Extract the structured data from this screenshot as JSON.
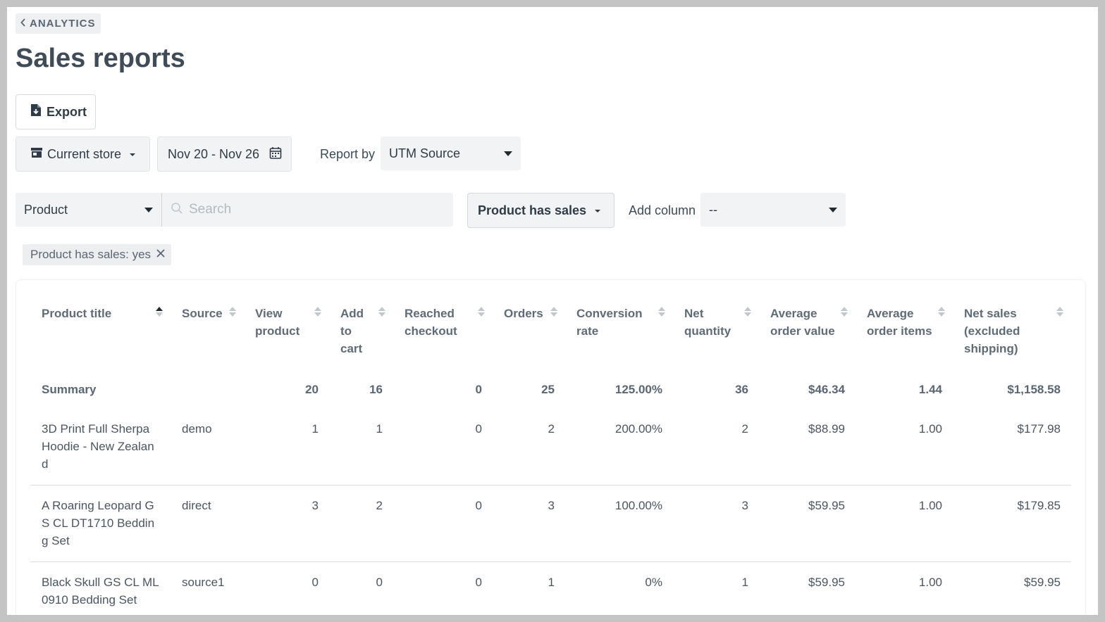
{
  "breadcrumb": {
    "label": "ANALYTICS"
  },
  "page": {
    "title": "Sales reports"
  },
  "toolbar": {
    "export_label": "Export",
    "store_label": "Current store",
    "date_range": "Nov 20 - Nov 26",
    "report_by_label": "Report by",
    "report_by_value": "UTM Source"
  },
  "filters": {
    "field_select": "Product",
    "search_placeholder": "Search",
    "has_sales_label": "Product has sales",
    "add_column_label": "Add column",
    "add_column_value": "--",
    "chips": [
      {
        "label": "Product has sales: yes"
      }
    ]
  },
  "table": {
    "columns": [
      "Product title",
      "Source",
      "View product",
      "Add to cart",
      "Reached checkout",
      "Orders",
      "Conversion rate",
      "Net quantity",
      "Average order value",
      "Average order items",
      "Net sales (excluded shipping)"
    ],
    "summary": {
      "label": "Summary",
      "source": "",
      "view_product": "20",
      "add_to_cart": "16",
      "reached_checkout": "0",
      "orders": "25",
      "conversion_rate": "125.00%",
      "net_quantity": "36",
      "avg_order_value": "$46.34",
      "avg_order_items": "1.44",
      "net_sales": "$1,158.58"
    },
    "rows": [
      {
        "title": "3D Print Full Sherpa Hoodie - New Zealand",
        "source": "demo",
        "view_product": "1",
        "add_to_cart": "1",
        "reached_checkout": "0",
        "orders": "2",
        "conversion_rate": "200.00%",
        "net_quantity": "2",
        "avg_order_value": "$88.99",
        "avg_order_items": "1.00",
        "net_sales": "$177.98"
      },
      {
        "title": "A Roaring Leopard GS CL DT1710 Bedding Set",
        "source": "direct",
        "view_product": "3",
        "add_to_cart": "2",
        "reached_checkout": "0",
        "orders": "3",
        "conversion_rate": "100.00%",
        "net_quantity": "3",
        "avg_order_value": "$59.95",
        "avg_order_items": "1.00",
        "net_sales": "$179.85"
      },
      {
        "title": "Black Skull GS CL ML0910 Bedding Set",
        "source": "source1",
        "view_product": "0",
        "add_to_cart": "0",
        "reached_checkout": "0",
        "orders": "1",
        "conversion_rate": "0%",
        "net_quantity": "1",
        "avg_order_value": "$59.95",
        "avg_order_items": "1.00",
        "net_sales": "$59.95"
      }
    ]
  }
}
